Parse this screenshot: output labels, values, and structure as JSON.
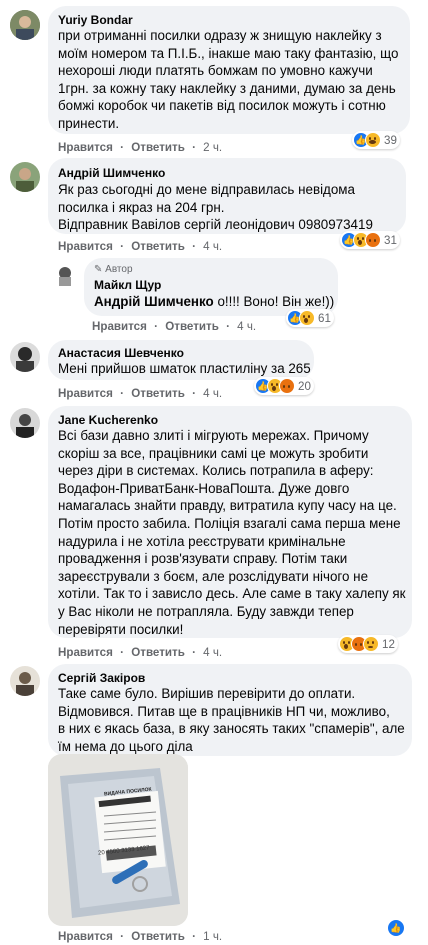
{
  "colors": {
    "bubble": "#f0f2f5",
    "meta": "#65676b",
    "like": "#1877f2",
    "wow": "#f7b928",
    "angry": "#e9710f"
  },
  "comments": [
    {
      "author": "Yuriy Bondar",
      "lines": [
        "при отриманні посилки одразу ж знищую наклейку з",
        "моїм номером та П.І.Б., інакше маю таку фантазію, що",
        "нехороші люди платять бомжам по умовно кажучи",
        "1грн. за кожну таку наклейку з даними, думаю за день",
        "бомжі коробок чи пакетів від посилок можуть і сотню",
        "принести."
      ],
      "like": "Нравится",
      "reply": "Ответить",
      "time": "2 ч.",
      "reactions_count": "39"
    },
    {
      "author": "Андрій Шимченко",
      "lines": [
        "Як раз сьогодні до мене відправилась невідома",
        "посилка і якраз на 204 грн.",
        "Відправник Вавілов сергій леонідович 0980973419"
      ],
      "like": "Нравится",
      "reply": "Ответить",
      "time": "4 ч.",
      "reactions_count": "31"
    },
    {
      "badge": "Автор",
      "author": "Майкл Щур",
      "mention": "Андрій Шимченко",
      "text": " о!!!! Воно! Він же!))",
      "like": "Нравится",
      "reply": "Ответить",
      "time": "4 ч.",
      "reactions_count": "61"
    },
    {
      "author": "Анастасия Шевченко",
      "lines": [
        "Мені прийшов шматок пластиліну за 265"
      ],
      "like": "Нравится",
      "reply": "Ответить",
      "time": "4 ч.",
      "reactions_count": "20"
    },
    {
      "author": "Jane Kucherenko",
      "lines": [
        "Всі бази давно злиті і мігрують мережах. Причому",
        "скоріш за все, працівники самі це можуть зробити",
        "через діри в системах. Колись потрапила в аферу:",
        "Водафон-ПриватБанк-НоваПошта. Дуже довго",
        "намагалась знайти правду, витратила купу часу на це.",
        "Потім просто забила. Поліція взагалі сама перша мене",
        "надурила і не хотіла реєструвати кримінальне",
        "провадження і розв'язувати справу. Потім таки",
        "зареєстрували з боєм, але розслідувати нічого не",
        "хотіли. Так то і зависло десь. Але саме в таку халепу як",
        "у Вас ніколи не потрапляла. Буду завжди тепер",
        "перевіряти посилки!"
      ],
      "like": "Нравится",
      "reply": "Ответить",
      "time": "4 ч.",
      "reactions_count": "12"
    },
    {
      "author": "Сергій Закіров",
      "lines": [
        "Таке саме було. Вирішив перевірити до оплати.",
        "Відмовився. Питав ще в працівників НП чи, можливо,",
        "в них є якась база, в яку заносять таких \"спамерів\", але",
        "їм нема до цього діла"
      ],
      "like": "Нравится",
      "reply": "Ответить",
      "time": "1 ч.",
      "photo_label": "ВИДАЧА ПОСИЛОК",
      "photo_number": "20 4500 3133 1627"
    }
  ]
}
